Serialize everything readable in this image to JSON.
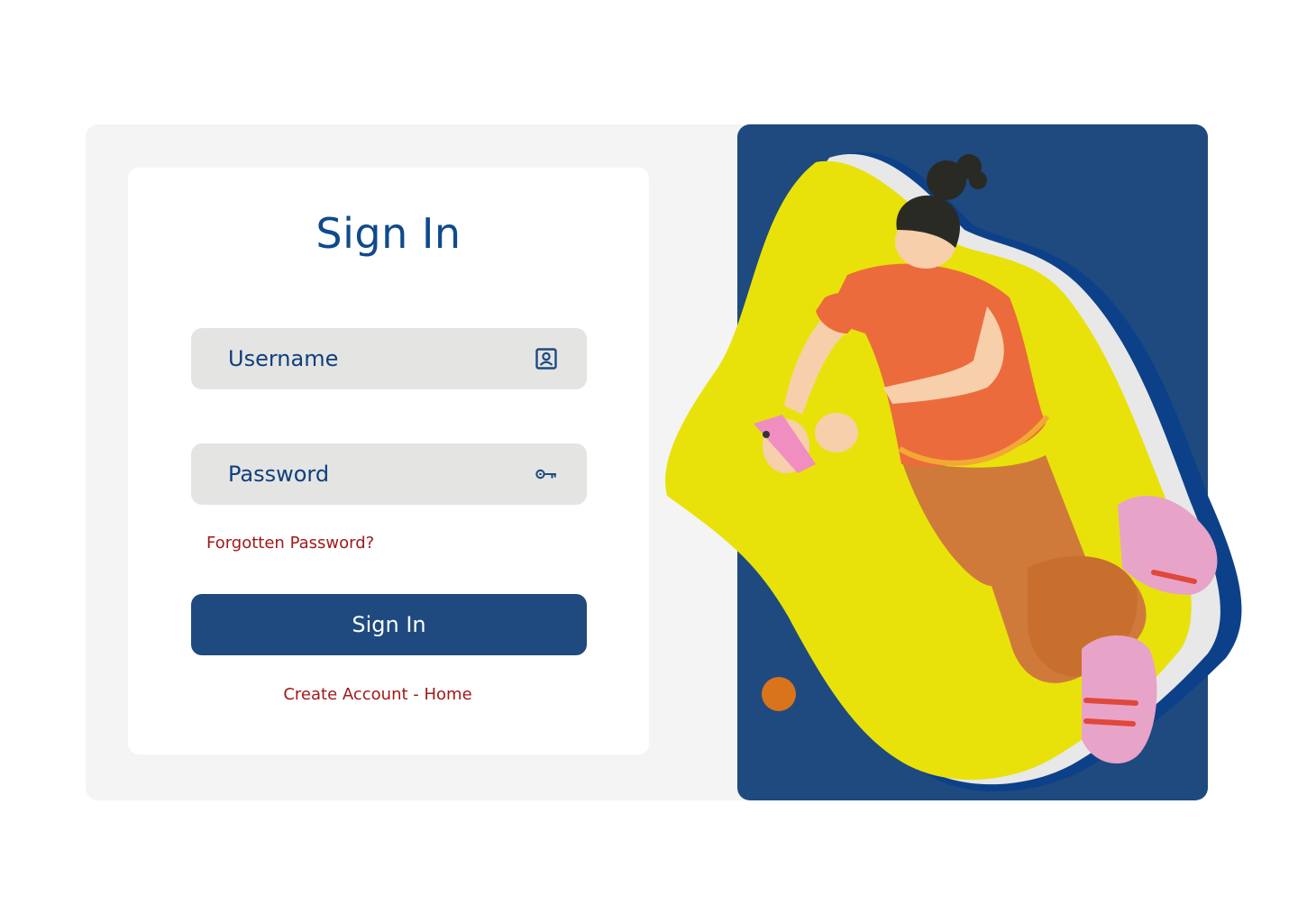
{
  "form": {
    "title": "Sign In",
    "username_placeholder": "Username",
    "password_placeholder": "Password",
    "forgot_label": "Forgotten Password?",
    "submit_label": "Sign In",
    "create_account_label": "Create Account",
    "separator": " - ",
    "home_label": "Home"
  },
  "icons": {
    "username": "contact-card-icon",
    "password": "key-icon"
  },
  "colors": {
    "primary_blue": "#1e4a7f",
    "title_blue": "#0f4a8c",
    "link_red": "#a01919",
    "blob_yellow": "#e8e20a",
    "accent_orange": "#d9731c"
  }
}
